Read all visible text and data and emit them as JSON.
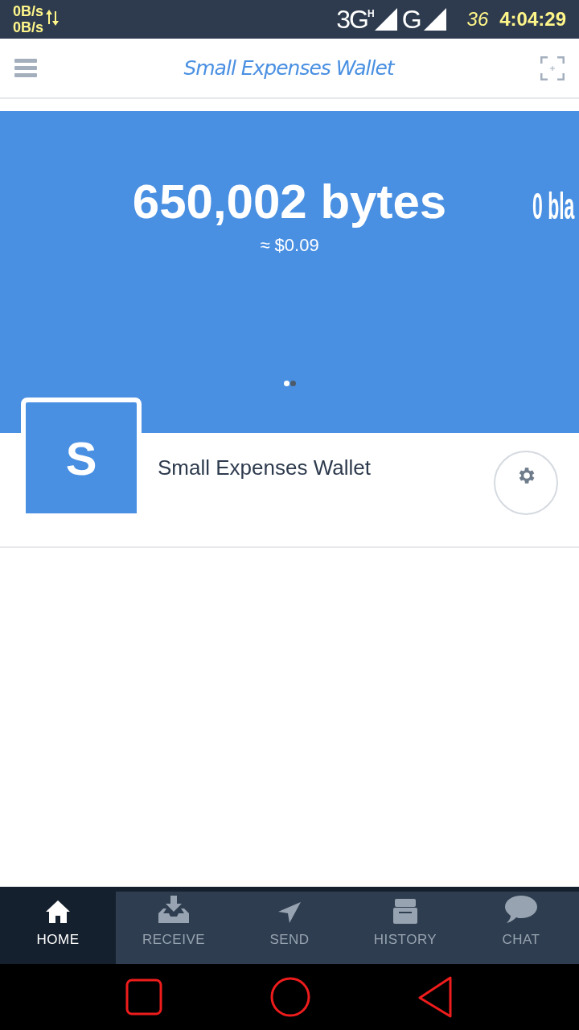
{
  "status_bar": {
    "upload_speed": "0B/s",
    "download_speed": "0B/s",
    "network_1": "3G",
    "network_1_badge": "H",
    "network_2": "G",
    "battery": "36",
    "time": "4:04:29"
  },
  "header": {
    "title": "Small Expenses Wallet"
  },
  "balance": {
    "amount": "650,002 bytes",
    "fiat": "≈ $0.09",
    "next_slide": "0 bla"
  },
  "carousel_dots": [
    {
      "selected": true
    },
    {
      "selected": false
    }
  ],
  "wallet": {
    "initial": "S",
    "name": "Small Expenses Wallet"
  },
  "tabs": [
    {
      "label": "HOME",
      "kind": "home",
      "selected": true
    },
    {
      "label": "RECEIVE",
      "kind": "receive",
      "selected": false
    },
    {
      "label": "SEND",
      "kind": "send",
      "selected": false
    },
    {
      "label": "HISTORY",
      "kind": "history",
      "selected": false
    },
    {
      "label": "CHAT",
      "kind": "chat",
      "selected": false
    }
  ]
}
